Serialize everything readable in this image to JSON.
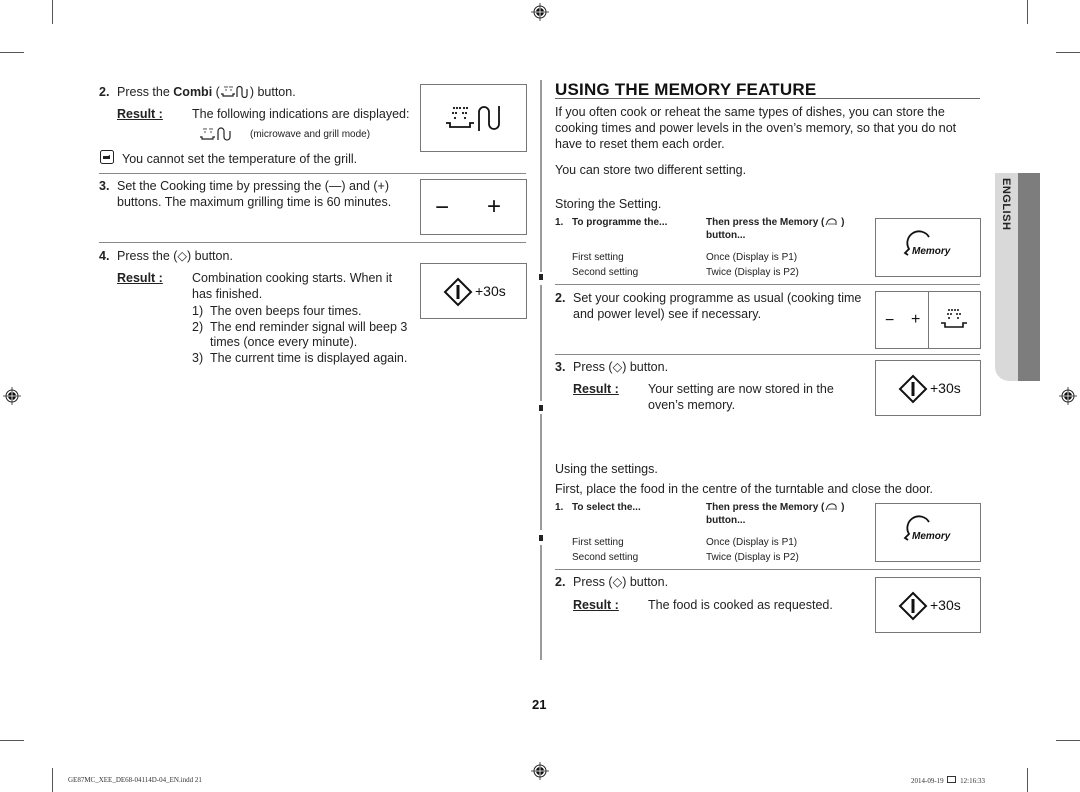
{
  "left": {
    "step2": {
      "number": "2.",
      "text_before": "Press the ",
      "bold": "Combi",
      "text_after": ") button.",
      "paren_open": " (",
      "result_label": "Result :",
      "result_text": "The following indications are displayed:",
      "mode_note": "(microwave and grill mode)",
      "display_icon": "microwave-grill-icon"
    },
    "note": {
      "icon": "note-hand-icon",
      "text": "You cannot set the temperature of the grill."
    },
    "step3": {
      "number": "3.",
      "line1": "Set the Cooking time by pressing the (—) and (+)",
      "line2": "buttons. The maximum grilling time is 60 minutes.",
      "display_minus": "−",
      "display_plus": "+"
    },
    "step4": {
      "number": "4.",
      "text": "Press the (◇) button.",
      "result_label": "Result :",
      "result_line1": "Combination cooking starts. When it",
      "result_line2": "has finished.",
      "list": [
        {
          "n": "1)",
          "text": "The oven beeps four times."
        },
        {
          "n": "2)",
          "text": "The end reminder signal will beep 3"
        },
        {
          "n": "",
          "text": "times (once every minute)."
        },
        {
          "n": "3)",
          "text": "The current time is displayed again."
        }
      ],
      "display_text": "+30s"
    }
  },
  "right": {
    "title": "USING THE MEMORY FEATURE",
    "intro_lines": [
      "If you often cook or reheat the same types of dishes, you can store the",
      "cooking times and power levels in the oven’s memory, so that you do not",
      "have to reset them each order."
    ],
    "store_two": "You can store two different setting.",
    "storing": {
      "heading": "Storing the Setting.",
      "step1": {
        "number": "1.",
        "col1_header": "To programme the...",
        "col2_header_line1": "Then press the Memory (",
        "col2_header_close": " )",
        "col2_header_line2": "button...",
        "rows": [
          {
            "setting": "First setting",
            "press": "Once (Display is P1)"
          },
          {
            "setting": "Second setting",
            "press": "Twice (Display is P2)"
          }
        ],
        "display_label": "Memory"
      },
      "step2": {
        "number": "2.",
        "line1": "Set your cooking programme as usual (cooking time",
        "line2": "and power level) see if necessary.",
        "display_minus": "−",
        "display_plus": "+"
      },
      "step3": {
        "number": "3.",
        "text": "Press (◇) button.",
        "result_label": "Result :",
        "result_line1": "Your setting are now stored in the",
        "result_line2": "oven’s memory.",
        "display_text": "+30s"
      }
    },
    "using": {
      "heading": "Using the settings.",
      "intro": "First, place the food in the centre of the turntable and close the door.",
      "step1": {
        "number": "1.",
        "col1_header": "To select the...",
        "col2_header_line1": "Then press the Memory (",
        "col2_header_close": " )",
        "col2_header_line2": "button...",
        "rows": [
          {
            "setting": "First setting",
            "press": "Once (Display is P1)"
          },
          {
            "setting": "Second setting",
            "press": "Twice (Display is P2)"
          }
        ],
        "display_label": "Memory"
      },
      "step2": {
        "number": "2.",
        "text": "Press (◇) button.",
        "result_label": "Result :",
        "result_text": "The food is cooked as requested.",
        "display_text": "+30s"
      }
    },
    "language_tab": "ENGLISH"
  },
  "page_number": "21",
  "footer": {
    "file": "GE87MC_XEE_DE68-04114D-04_EN.indd   21",
    "date": "2014-09-19",
    "time": "12:16:33"
  },
  "colors": {
    "rule": "#888888",
    "tab_light": "#d9d9d9",
    "tab_dark": "#7d7d7d"
  }
}
